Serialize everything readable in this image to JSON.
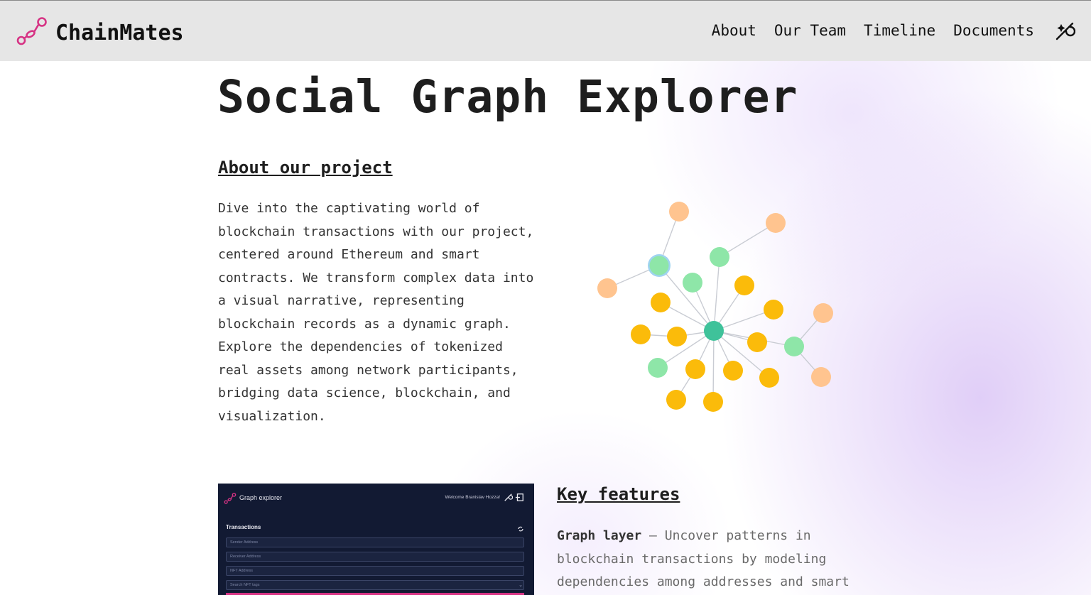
{
  "header": {
    "brand": "ChainMates",
    "nav": [
      "About",
      "Our Team",
      "Timeline",
      "Documents"
    ]
  },
  "hero": {
    "title": "Social Graph Explorer"
  },
  "about": {
    "heading": "About our project",
    "text": "Dive into the captivating world of blockchain transactions with our project, centered around Ethereum and smart contracts. We transform complex data into a visual narrative, representing blockchain records as a dynamic graph. Explore the dependencies of tokenized real assets among network participants, bridging data science, blockchain, and visualization."
  },
  "preview": {
    "title": "Graph explorer",
    "welcome": "Welcome Branislav Hozza!",
    "section": "Transactions",
    "inputs": [
      "Sender Address",
      "Receiver Address",
      "NFT Address",
      "Search NFT tags"
    ]
  },
  "features": {
    "heading": "Key features",
    "item_title": "Graph layer",
    "item_text": " – Uncover patterns in blockchain transactions by modeling dependencies among addresses and smart"
  },
  "colors": {
    "accent": "#d63384",
    "node_orange_light": "#ffc48f",
    "node_yellow": "#fbbb0a",
    "node_green_light": "#8ee6a8",
    "node_green_dark": "#3fc29a"
  }
}
